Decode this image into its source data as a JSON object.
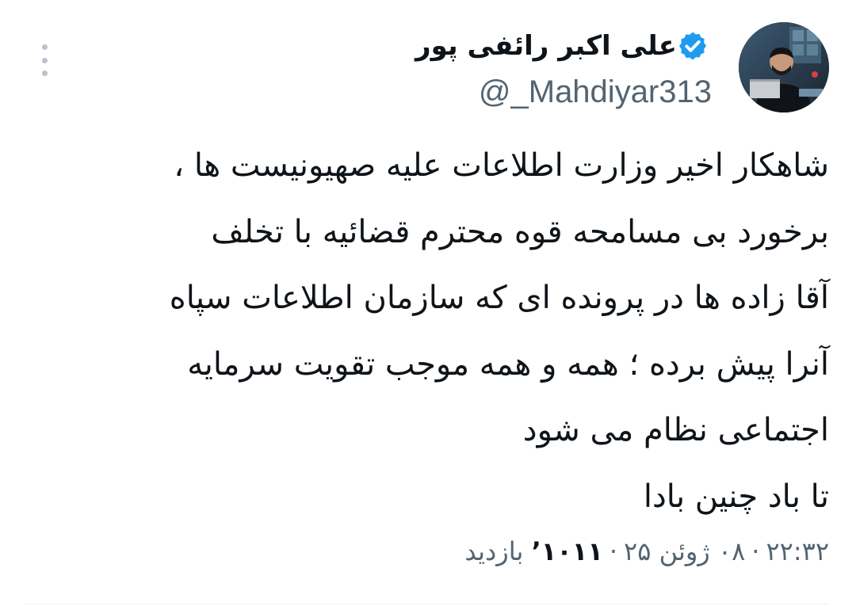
{
  "author": {
    "display_name": "علی اکبر رائفی پور",
    "handle": "@_Mahdiyar313",
    "verified": true,
    "avatar_icon": "profile-photo"
  },
  "tweet": {
    "lines": [
      "شاهکار اخیر وزارت اطلاعات علیه صهیونیست ها ،",
      "برخورد بی مسامحه قوه محترم قضائیه با تخلف",
      "آقا زاده ها در پرونده ای که سازمان اطلاعات سپاه",
      "آنرا پیش برده ؛ همه و همه موجب تقویت سرمایه",
      "اجتماعی نظام می شود",
      "تا باد چنین بادا"
    ]
  },
  "meta": {
    "time": "۲۲:۳۲",
    "date": "۰۸ ژوئن ۲۵",
    "views_count": "۱۰۱۱",
    "views_suffix": "’",
    "views_label": "بازدید",
    "separator": "·"
  },
  "colors": {
    "text": "#0f1419",
    "secondary": "#536471",
    "verified": "#1d9bf0",
    "menu_dots": "#b8c2cc"
  }
}
